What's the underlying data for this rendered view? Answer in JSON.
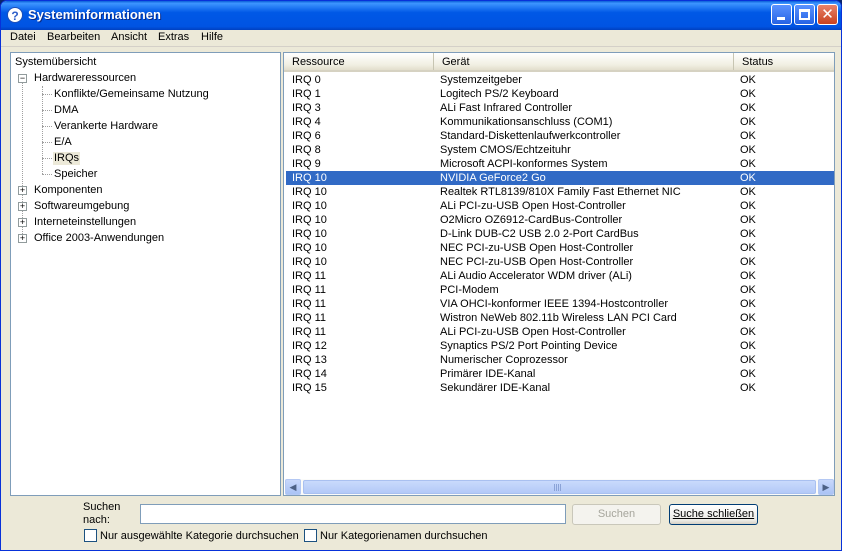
{
  "window": {
    "title": "Systeminformationen"
  },
  "menu": [
    "Datei",
    "Bearbeiten",
    "Ansicht",
    "Extras",
    "Hilfe"
  ],
  "tree": {
    "root": "Systemübersicht",
    "nodes": [
      {
        "label": "Hardwareressourcen",
        "expander": "−"
      },
      {
        "label": "Konflikte/Gemeinsame Nutzung"
      },
      {
        "label": "DMA"
      },
      {
        "label": "Verankerte Hardware"
      },
      {
        "label": "E/A"
      },
      {
        "label": "IRQs",
        "selected": true
      },
      {
        "label": "Speicher"
      },
      {
        "label": "Komponenten",
        "expander": "+"
      },
      {
        "label": "Softwareumgebung",
        "expander": "+"
      },
      {
        "label": "Interneteinstellungen",
        "expander": "+"
      },
      {
        "label": "Office 2003-Anwendungen",
        "expander": "+"
      }
    ]
  },
  "list": {
    "columns": [
      "Ressource",
      "Gerät",
      "Status"
    ],
    "selected_index": 7,
    "rows": [
      [
        "IRQ 0",
        "Systemzeitgeber",
        "OK"
      ],
      [
        "IRQ 1",
        "Logitech PS/2 Keyboard",
        "OK"
      ],
      [
        "IRQ 3",
        "ALi Fast Infrared Controller",
        "OK"
      ],
      [
        "IRQ 4",
        "Kommunikationsanschluss (COM1)",
        "OK"
      ],
      [
        "IRQ 6",
        "Standard-Diskettenlaufwerkcontroller",
        "OK"
      ],
      [
        "IRQ 8",
        "System CMOS/Echtzeituhr",
        "OK"
      ],
      [
        "IRQ 9",
        "Microsoft ACPI-konformes System",
        "OK"
      ],
      [
        "IRQ 10",
        "NVIDIA GeForce2 Go",
        "OK"
      ],
      [
        "IRQ 10",
        "Realtek RTL8139/810X Family Fast Ethernet NIC",
        "OK"
      ],
      [
        "IRQ 10",
        "ALi PCI-zu-USB Open Host-Controller",
        "OK"
      ],
      [
        "IRQ 10",
        "O2Micro OZ6912-CardBus-Controller",
        "OK"
      ],
      [
        "IRQ 10",
        "D-Link DUB-C2 USB 2.0 2-Port CardBus",
        "OK"
      ],
      [
        "IRQ 10",
        "NEC PCI-zu-USB Open Host-Controller",
        "OK"
      ],
      [
        "IRQ 10",
        "NEC PCI-zu-USB Open Host-Controller",
        "OK"
      ],
      [
        "IRQ 11",
        "ALi Audio Accelerator WDM driver (ALi)",
        "OK"
      ],
      [
        "IRQ 11",
        "PCI-Modem",
        "OK"
      ],
      [
        "IRQ 11",
        "VIA OHCI-konformer IEEE 1394-Hostcontroller",
        "OK"
      ],
      [
        "IRQ 11",
        "Wistron NeWeb 802.11b Wireless LAN PCI Card",
        "OK"
      ],
      [
        "IRQ 11",
        "ALi PCI-zu-USB Open Host-Controller",
        "OK"
      ],
      [
        "IRQ 12",
        "Synaptics PS/2 Port Pointing Device",
        "OK"
      ],
      [
        "IRQ 13",
        "Numerischer Coprozessor",
        "OK"
      ],
      [
        "IRQ 14",
        "Primärer IDE-Kanal",
        "OK"
      ],
      [
        "IRQ 15",
        "Sekundärer IDE-Kanal",
        "OK"
      ]
    ]
  },
  "search": {
    "label": "Suchen nach:",
    "value": "",
    "search_button": "Suchen",
    "close_button": "Suche schließen",
    "only_selected_category": "Nur ausgewählte Kategorie durchsuchen",
    "only_category_names": "Nur Kategorienamen durchsuchen"
  }
}
